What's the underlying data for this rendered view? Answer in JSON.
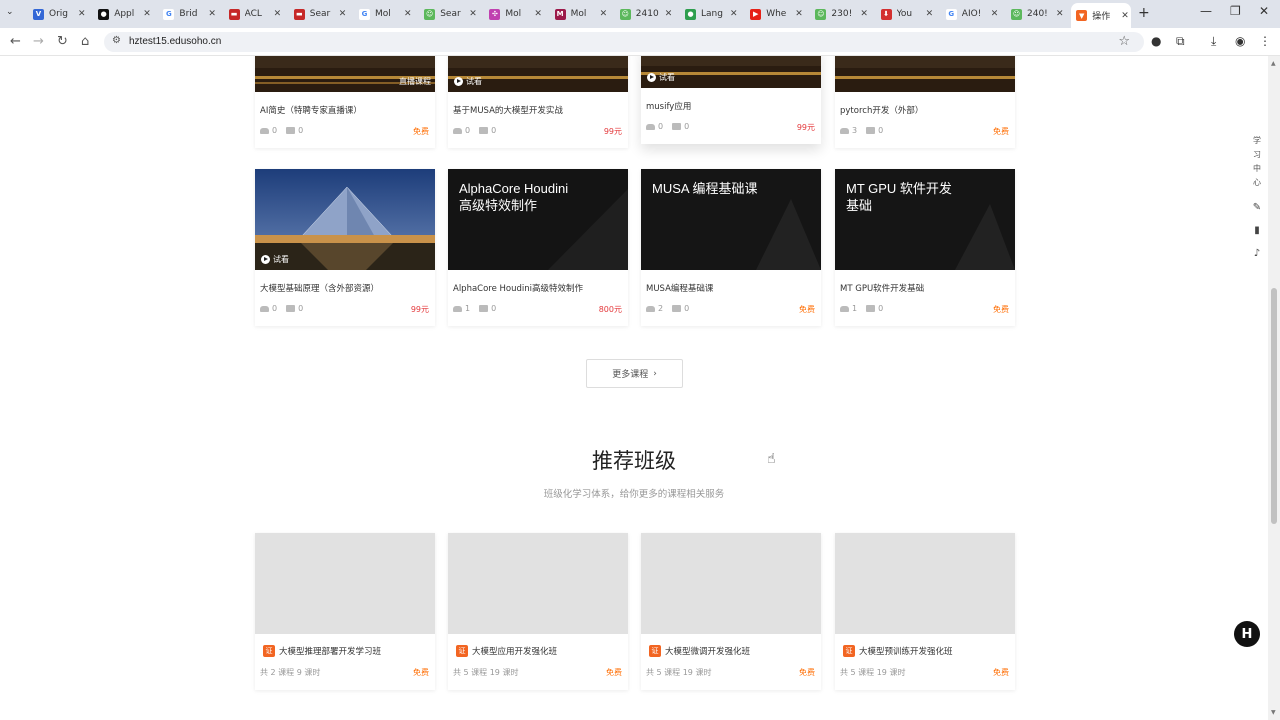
{
  "browser": {
    "tabs": [
      {
        "title": "Orig",
        "color": "#3367d6",
        "glyph": "V"
      },
      {
        "title": "Appl",
        "color": "#111111",
        "glyph": "●"
      },
      {
        "title": "Brid",
        "color": "#ffffff",
        "glyph": "G"
      },
      {
        "title": "ACL",
        "color": "#c62828",
        "glyph": "▬"
      },
      {
        "title": "Sear",
        "color": "#c62828",
        "glyph": "▬"
      },
      {
        "title": "Mol",
        "color": "#ffffff",
        "glyph": "G"
      },
      {
        "title": "Sear",
        "color": "#5cb85c",
        "glyph": "☺"
      },
      {
        "title": "Mol",
        "color": "#c040b0",
        "glyph": "✣"
      },
      {
        "title": "Mol",
        "color": "#9c1a4a",
        "glyph": "M"
      },
      {
        "title": "2410",
        "color": "#5cb85c",
        "glyph": "☺"
      },
      {
        "title": "Lang",
        "color": "#2e9e4e",
        "glyph": "●"
      },
      {
        "title": "Whe",
        "color": "#e62117",
        "glyph": "▶"
      },
      {
        "title": "230!",
        "color": "#5cb85c",
        "glyph": "☺"
      },
      {
        "title": "You",
        "color": "#d32f2f",
        "glyph": "⬇"
      },
      {
        "title": "AIO!",
        "color": "#ffffff",
        "glyph": "G"
      },
      {
        "title": "240!",
        "color": "#5cb85c",
        "glyph": "☺"
      },
      {
        "title": "操作",
        "color": "#f26522",
        "glyph": "▼"
      }
    ],
    "url": "hztest15.edusoho.cn"
  },
  "courses_row1": [
    {
      "title": "AI简史（特聘专家直播课）",
      "students": "0",
      "comments": "0",
      "price": "免费",
      "price_type": "free",
      "badge": "直播课程"
    },
    {
      "title": "基于MUSA的大模型开发实战",
      "students": "0",
      "comments": "0",
      "price": "99元",
      "price_type": "paid",
      "badge": "试看"
    },
    {
      "title": "musify应用",
      "students": "0",
      "comments": "0",
      "price": "99元",
      "price_type": "paid",
      "badge": "试看"
    },
    {
      "title": "pytorch开发（外部）",
      "students": "3",
      "comments": "0",
      "price": "免费",
      "price_type": "free",
      "badge": ""
    }
  ],
  "courses_row2": [
    {
      "title": "大模型基础原理（含外部资源）",
      "students": "0",
      "comments": "0",
      "price": "99元",
      "price_type": "paid",
      "badge": "试看",
      "overlay": ""
    },
    {
      "title": "AlphaCore Houdini高级特效制作",
      "students": "1",
      "comments": "0",
      "price": "800元",
      "price_type": "paid",
      "badge": "",
      "overlay": "AlphaCore Houdini\n高级特效制作"
    },
    {
      "title": "MUSA编程基础课",
      "students": "2",
      "comments": "0",
      "price": "免费",
      "price_type": "free",
      "badge": "",
      "overlay": "MUSA 编程基础课"
    },
    {
      "title": "MT GPU软件开发基础",
      "students": "1",
      "comments": "0",
      "price": "免费",
      "price_type": "free",
      "badge": "",
      "overlay": "MT GPU 软件开发\n基础"
    }
  ],
  "more_courses": "更多课程",
  "classes_section": {
    "title": "推荐班级",
    "subtitle": "班级化学习体系，给你更多的课程相关服务",
    "cert_glyph": "证",
    "items": [
      {
        "title": "大模型推理部署开发学习班",
        "meta": "共 2 课程 9 课时",
        "price": "免费"
      },
      {
        "title": "大模型应用开发强化班",
        "meta": "共 5 课程 19 课时",
        "price": "免费"
      },
      {
        "title": "大模型微调开发强化班",
        "meta": "共 5 课程 19 课时",
        "price": "免费"
      },
      {
        "title": "大模型预训练开发强化班",
        "meta": "共 5 课程 19 课时",
        "price": "免费"
      }
    ]
  },
  "side_tools": {
    "vertical_label": [
      "学",
      "习",
      "中",
      "心"
    ]
  },
  "colors": {
    "free": "#ff6c00",
    "paid": "#e4393c",
    "cert": "#f26522"
  }
}
